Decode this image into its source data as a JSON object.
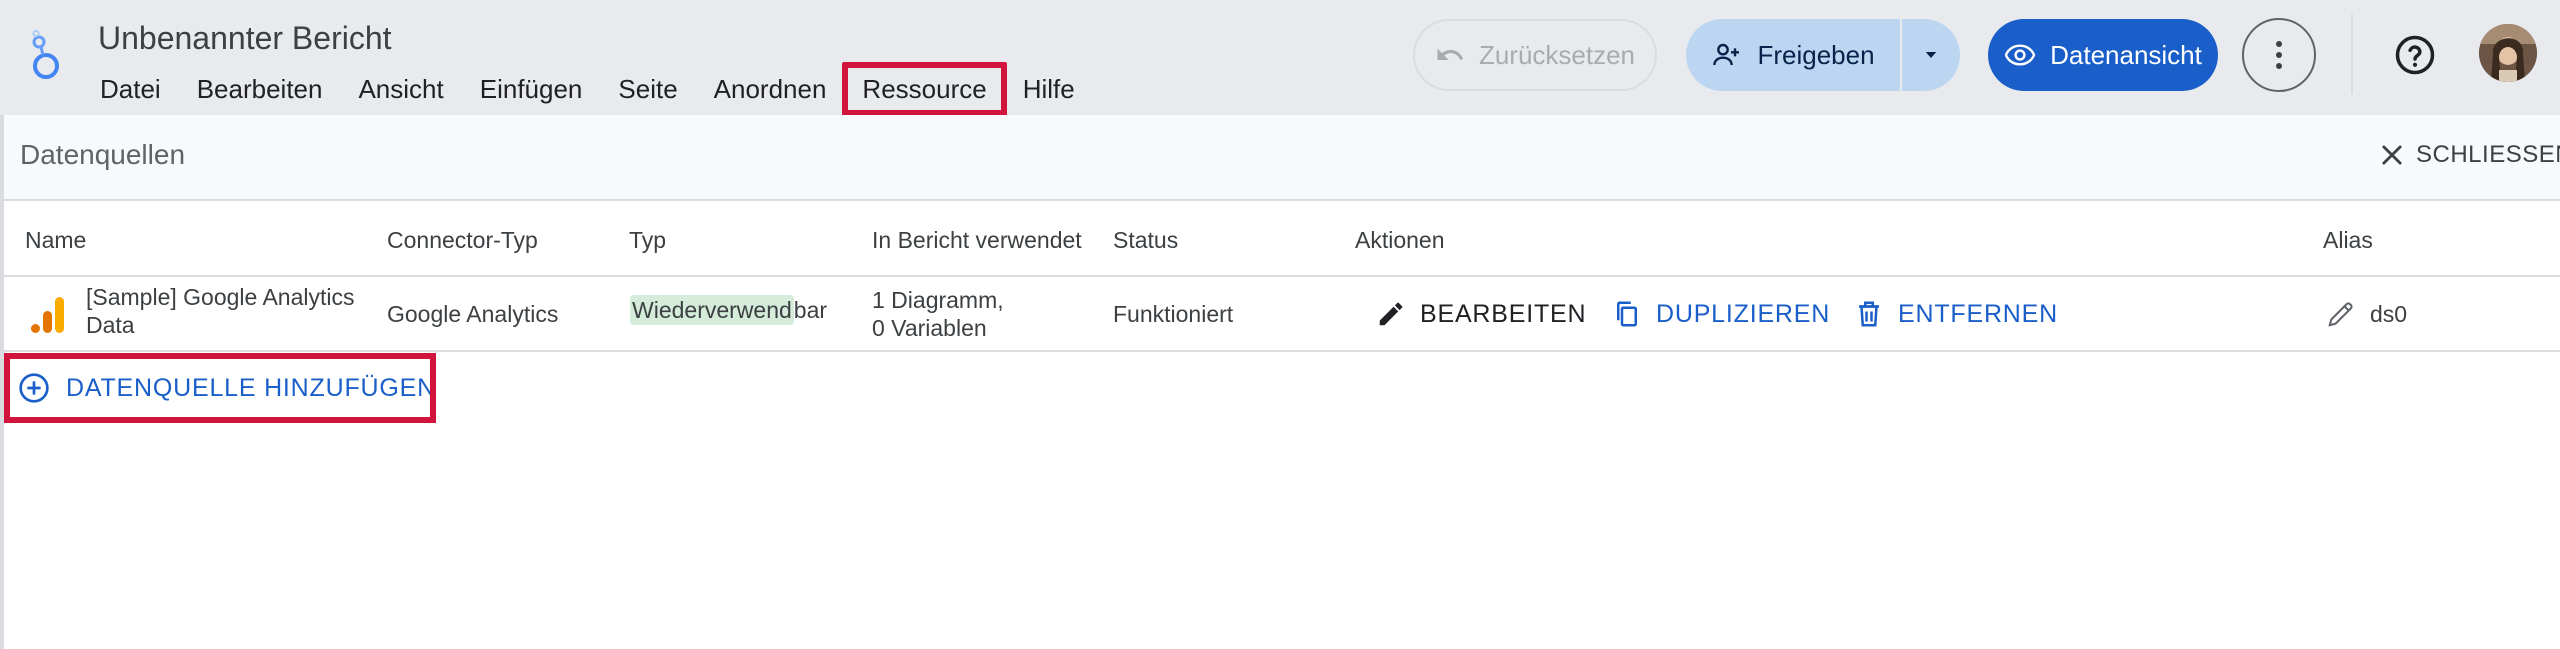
{
  "header": {
    "title": "Unbenannter Bericht",
    "menu": [
      "Datei",
      "Bearbeiten",
      "Ansicht",
      "Einfügen",
      "Seite",
      "Anordnen",
      "Ressource",
      "Hilfe"
    ],
    "highlighted_menu": "Ressource",
    "reset_label": "Zurücksetzen",
    "share_label": "Freigeben",
    "view_label": "Datenansicht",
    "icons": {
      "logo": "looker-studio-logo-icon",
      "reset": "undo-icon",
      "share": "person-add-icon",
      "share_dropdown": "caret-down-icon",
      "view": "eye-icon",
      "more": "more-vert-icon",
      "help": "help-circle-icon"
    }
  },
  "panel": {
    "title": "Datenquellen",
    "close_label": "SCHLIESSEN",
    "columns": {
      "name": "Name",
      "connector": "Connector-Typ",
      "type": "Typ",
      "used_in_report": "In Bericht verwendet",
      "status": "Status",
      "actions": "Aktionen",
      "alias": "Alias"
    },
    "rows": [
      {
        "name_line1": "[Sample] Google Analytics",
        "name_line2": "Data",
        "connector": "Google Analytics",
        "type_highlight": "Wiederverwend",
        "type_rest": "bar",
        "used_line1": "1 Diagramm,",
        "used_line2": "0 Variablen",
        "status": "Funktioniert",
        "action_edit": "BEARBEITEN",
        "action_duplicate": "DUPLIZIEREN",
        "action_remove": "ENTFERNEN",
        "alias": "ds0"
      }
    ],
    "add_label": "DATENQUELLE HINZUFÜGEN"
  },
  "colors": {
    "accent_blue": "#1a5fc9",
    "highlight_red": "#d0143b",
    "badge_green": "#d4ecd9",
    "header_bg": "#e8eaed"
  }
}
